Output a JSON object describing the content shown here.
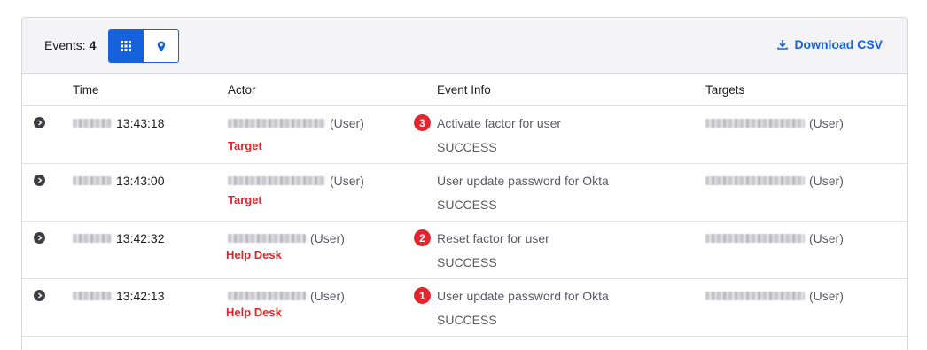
{
  "toolbar": {
    "events_label": "Events:",
    "events_count": "4",
    "download_label": "Download CSV"
  },
  "columns": {
    "time": "Time",
    "actor": "Actor",
    "event": "Event Info",
    "targets": "Targets"
  },
  "rows": [
    {
      "time": "13:43:18",
      "actor_suffix": "(User)",
      "role": "Target",
      "badge": "3",
      "event": "Activate factor for user",
      "status": "SUCCESS",
      "target_suffix": "(User)"
    },
    {
      "time": "13:43:00",
      "actor_suffix": "(User)",
      "role": "Target",
      "badge": "",
      "event": "User update password for Okta",
      "status": "SUCCESS",
      "target_suffix": "(User)"
    },
    {
      "time": "13:42:32",
      "actor_suffix": "(User)",
      "role": "Help Desk",
      "badge": "2",
      "event": "Reset factor for user",
      "status": "SUCCESS",
      "target_suffix": "(User)"
    },
    {
      "time": "13:42:13",
      "actor_suffix": "(User)",
      "role": "Help Desk",
      "badge": "1",
      "event": "User update password for Okta",
      "status": "SUCCESS",
      "target_suffix": "(User)"
    }
  ],
  "colors": {
    "accent": "#1662dd",
    "badge": "#e3262d"
  },
  "icons": {
    "grid_view": "grid-icon",
    "map_view": "map-pin-icon",
    "download": "download-icon",
    "expand": "chevron-right-icon"
  }
}
